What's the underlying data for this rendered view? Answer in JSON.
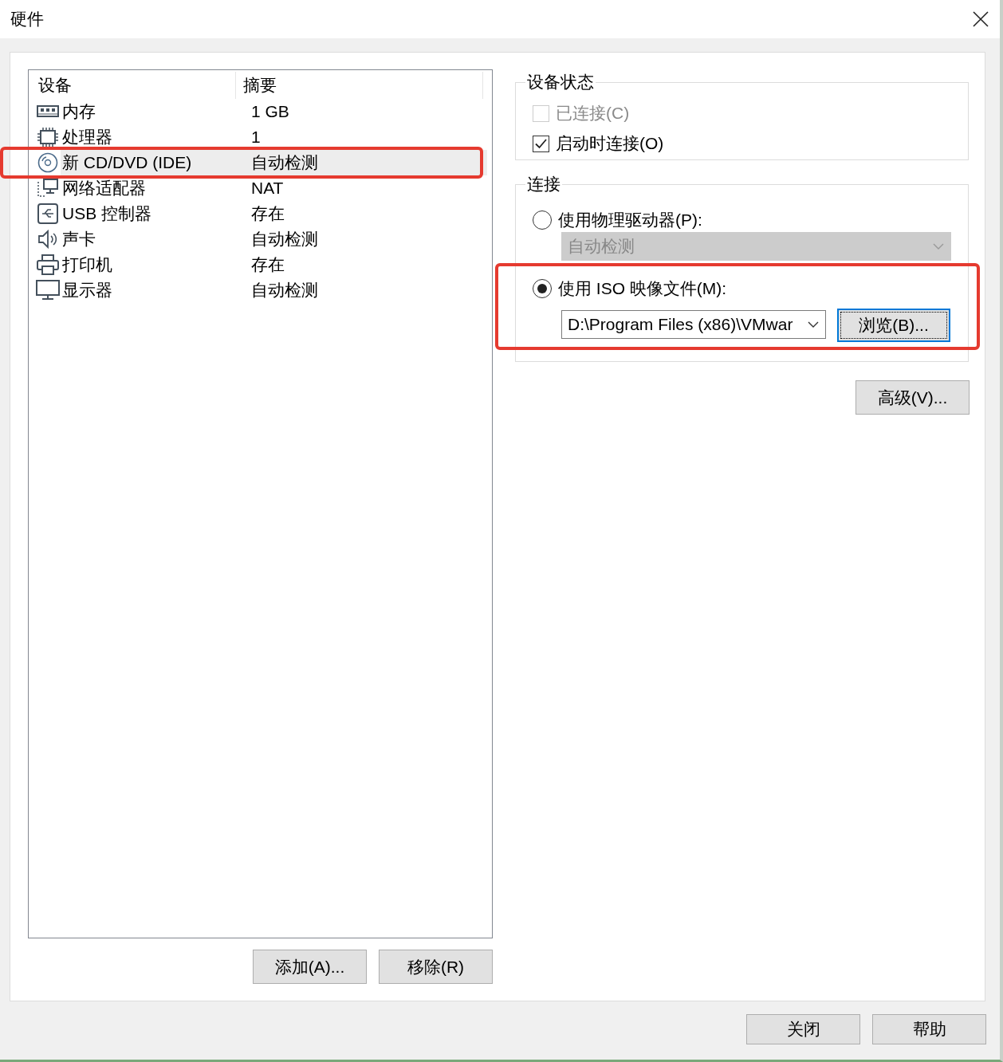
{
  "window": {
    "title": "硬件"
  },
  "device_list": {
    "columns": [
      "设备",
      "摘要"
    ],
    "rows": [
      {
        "kind": "memory",
        "device": "内存",
        "summary": "1 GB",
        "selected": false,
        "annotated": false
      },
      {
        "kind": "cpu",
        "device": "处理器",
        "summary": "1",
        "selected": false,
        "annotated": false
      },
      {
        "kind": "disc",
        "device": "新 CD/DVD (IDE)",
        "summary": "自动检测",
        "selected": true,
        "annotated": true
      },
      {
        "kind": "network",
        "device": "网络适配器",
        "summary": "NAT",
        "selected": false,
        "annotated": false
      },
      {
        "kind": "usb",
        "device": "USB 控制器",
        "summary": "存在",
        "selected": false,
        "annotated": false
      },
      {
        "kind": "sound",
        "device": "声卡",
        "summary": "自动检测",
        "selected": false,
        "annotated": false
      },
      {
        "kind": "printer",
        "device": "打印机",
        "summary": "存在",
        "selected": false,
        "annotated": false
      },
      {
        "kind": "display",
        "device": "显示器",
        "summary": "自动检测",
        "selected": false,
        "annotated": false
      }
    ]
  },
  "list_buttons": [
    "添加(A)...",
    "移除(R)"
  ],
  "device_status": {
    "title": "设备状态",
    "options": [
      {
        "label": "已连接(C)",
        "checked": false,
        "disabled": true
      },
      {
        "label": "启动时连接(O)",
        "checked": true,
        "disabled": false
      }
    ]
  },
  "connection": {
    "title": "连接",
    "options": [
      {
        "label": "使用物理驱动器(P):",
        "selected": false,
        "annotated": false,
        "dropdown": {
          "value": "自动检测",
          "disabled": true
        }
      },
      {
        "label": "使用 ISO 映像文件(M):",
        "selected": true,
        "annotated": true,
        "dropdown": {
          "value": "D:\\Program Files (x86)\\VMwar",
          "disabled": false
        },
        "button": {
          "label": "浏览(B)...",
          "focused": true
        }
      }
    ]
  },
  "advanced_button": "高级(V)...",
  "footer_buttons": [
    "关闭",
    "帮助"
  ]
}
